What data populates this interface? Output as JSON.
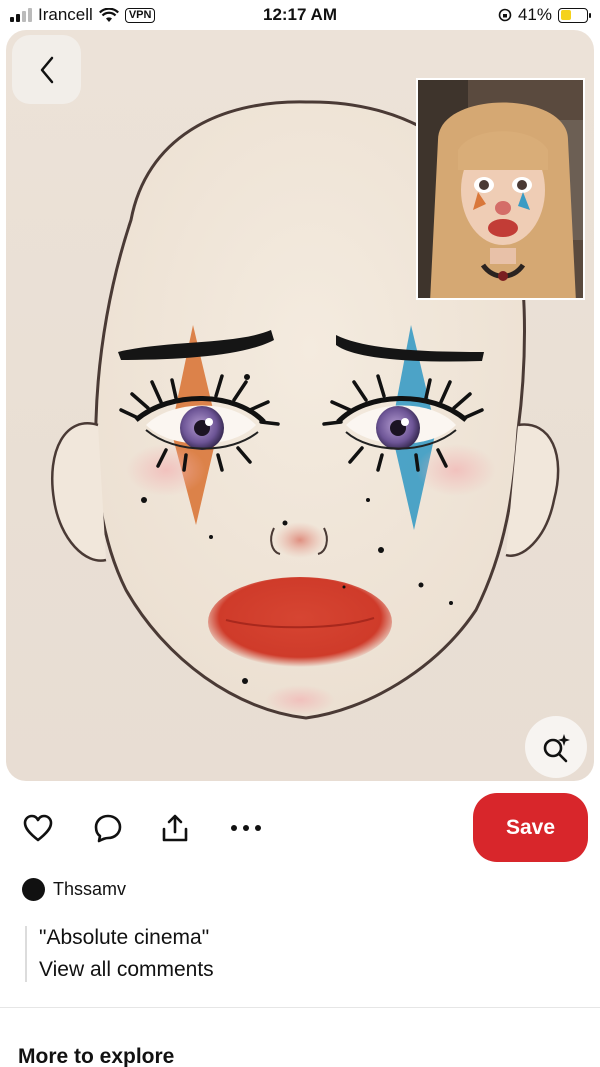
{
  "status_bar": {
    "carrier": "Irancell",
    "vpn": "VPN",
    "time": "12:17 AM",
    "battery": "41%",
    "battery_level": 0.41
  },
  "pin": {
    "image_icon": "clown-makeup-face-illustration",
    "inset_icon": "reference-photo-thumbnail"
  },
  "actions": {
    "save_label": "Save"
  },
  "author": {
    "name": "Thssamv"
  },
  "comments": {
    "top_comment": "\"Absolute cinema\"",
    "view_all": "View all comments"
  },
  "more": {
    "title": "More to explore"
  },
  "colors": {
    "save_button": "#d8262b",
    "orange_paint": "#d9773a",
    "blue_paint": "#3a9bc4",
    "lip_red": "#d1402e"
  }
}
